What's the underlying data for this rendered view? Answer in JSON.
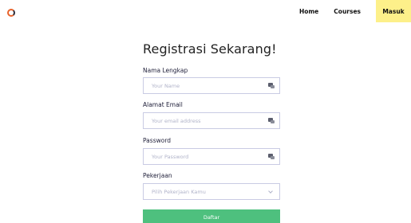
{
  "header": {
    "logo": "logo-icon",
    "nav": {
      "home": "Home",
      "courses": "Courses",
      "login": "Masuk"
    }
  },
  "form": {
    "title": "Registrasi Sekarang!",
    "name": {
      "label": "Nama Lengkap",
      "placeholder": "Your Name"
    },
    "email": {
      "label": "Alamat Email",
      "placeholder": "Your email address"
    },
    "password": {
      "label": "Password",
      "placeholder": "Your Password"
    },
    "job": {
      "label": "Pekerjaan",
      "placeholder": "Pilih Pekerjaan Kamu"
    },
    "submit": "Daftar"
  },
  "colors": {
    "accent_yellow": "#fdf08a",
    "submit_green": "#4ec07e",
    "field_border": "#c9cbe3"
  }
}
